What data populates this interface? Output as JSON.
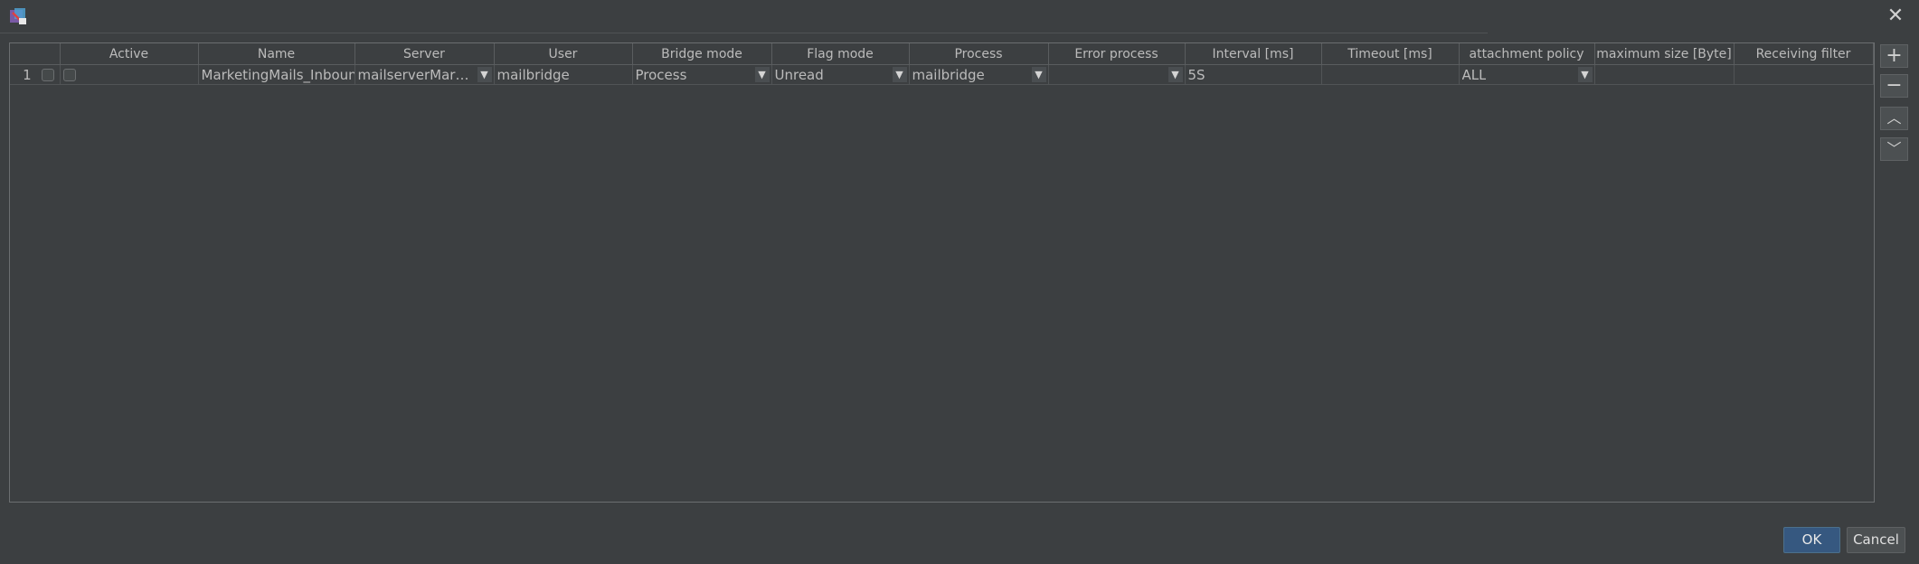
{
  "window": {
    "app_icon": "app-logo-icon",
    "close_icon": "close-icon",
    "close_glyph": "✕"
  },
  "table": {
    "columns": [
      "",
      "Active",
      "Name",
      "Server",
      "User",
      "Bridge mode",
      "Flag mode",
      "Process",
      "Error process",
      "Interval [ms]",
      "Timeout [ms]",
      "attachment policy",
      "maximum size [Byte]",
      "Receiving filter"
    ],
    "rows": [
      {
        "row_number": "1",
        "select_checked": false,
        "active_checked": false,
        "name": "MarketingMails_Inbound",
        "server": "mailserverMarket...",
        "user": "mailbridge",
        "bridge_mode": "Process",
        "flag_mode": "Unread",
        "process": "mailbridge",
        "error_process": "",
        "interval": "5S",
        "timeout": "",
        "attachment_policy": "ALL",
        "maximum_size": "",
        "receiving_filter": ""
      }
    ]
  },
  "side_buttons": {
    "add": "+",
    "remove": "−",
    "up": "︿",
    "down": "﹀"
  },
  "footer": {
    "ok_label": "OK",
    "cancel_label": "Cancel"
  },
  "colors": {
    "background": "#3c3f41",
    "accent": "#365880",
    "text": "#bbbbbb"
  }
}
